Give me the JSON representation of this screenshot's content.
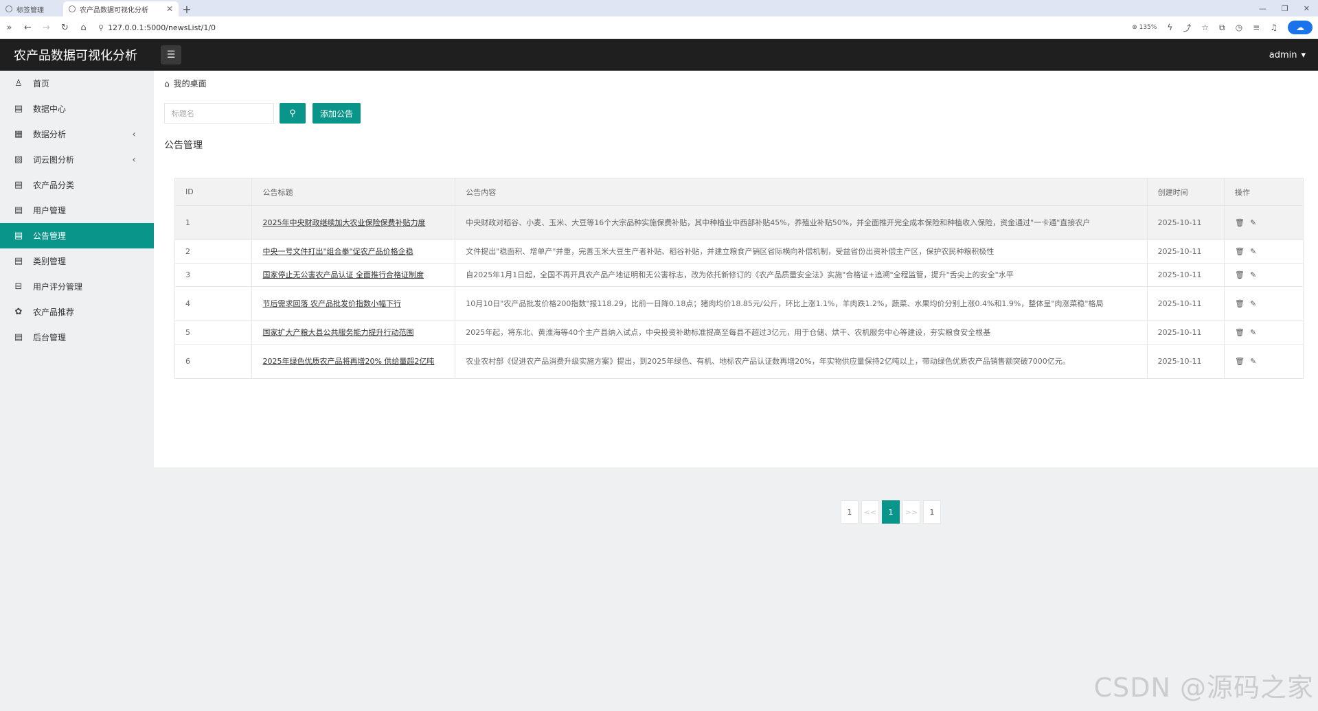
{
  "browser": {
    "tabs": [
      {
        "label": "标签管理",
        "active": false
      },
      {
        "label": "农产品数据可视化分析",
        "active": true
      }
    ],
    "url": "127.0.0.1:5000/newsList/1/0",
    "zoom": "135%"
  },
  "app": {
    "title": "农产品数据可视化分析",
    "user": "admin"
  },
  "sidebar": {
    "items": [
      {
        "label": "首页",
        "icon": "user-icon",
        "active": false,
        "expandable": false
      },
      {
        "label": "数据中心",
        "icon": "document-icon",
        "active": false,
        "expandable": false
      },
      {
        "label": "数据分析",
        "icon": "table-icon",
        "active": false,
        "expandable": true
      },
      {
        "label": "词云图分析",
        "icon": "image-icon",
        "active": false,
        "expandable": true
      },
      {
        "label": "农产品分类",
        "icon": "document-icon",
        "active": false,
        "expandable": false
      },
      {
        "label": "用户管理",
        "icon": "document-icon",
        "active": false,
        "expandable": false
      },
      {
        "label": "公告管理",
        "icon": "document-icon",
        "active": true,
        "expandable": false
      },
      {
        "label": "类别管理",
        "icon": "document-icon",
        "active": false,
        "expandable": false
      },
      {
        "label": "用户评分管理",
        "icon": "book-icon",
        "active": false,
        "expandable": false
      },
      {
        "label": "农产品推荐",
        "icon": "plant-icon",
        "active": false,
        "expandable": false
      },
      {
        "label": "后台管理",
        "icon": "document-icon",
        "active": false,
        "expandable": false
      }
    ]
  },
  "breadcrumb": "我的桌面",
  "search": {
    "placeholder": "标题名",
    "value": "",
    "add_label": "添加公告"
  },
  "section_title": "公告管理",
  "table": {
    "headers": [
      "ID",
      "公告标题",
      "公告内容",
      "创建时间",
      "操作"
    ],
    "rows": [
      {
        "id": "1",
        "title": "2025年中央财政继续加大农业保险保费补贴力度",
        "content": "中央财政对稻谷、小麦、玉米、大豆等16个大宗品种实施保费补贴，其中种植业中西部补贴45%，养殖业补贴50%，并全面推开完全成本保险和种植收入保险，资金通过\"一卡通\"直接农户",
        "date": "2025-10-11"
      },
      {
        "id": "2",
        "title": "中央一号文件打出\"组合拳\"促农产品价格企稳",
        "content": "文件提出\"稳面积、增单产\"并重，完善玉米大豆生产者补贴、稻谷补贴，并建立粮食产销区省际横向补偿机制，受益省份出资补偿主产区，保护农民种粮积极性",
        "date": "2025-10-11"
      },
      {
        "id": "3",
        "title": "国家停止无公害农产品认证 全面推行合格证制度",
        "content": "自2025年1月1日起，全国不再开具农产品产地证明和无公害标志，改为依托新修订的《农产品质量安全法》实施\"合格证+追溯\"全程监管，提升\"舌尖上的安全\"水平",
        "date": "2025-10-11"
      },
      {
        "id": "4",
        "title": "节后需求回落 农产品批发价指数小幅下行",
        "content": "10月10日\"农产品批发价格200指数\"报118.29，比前一日降0.18点；猪肉均价18.85元/公斤，环比上涨1.1%，羊肉跌1.2%，蔬菜、水果均价分别上涨0.4%和1.9%，整体呈\"肉涨菜稳\"格局",
        "date": "2025-10-11"
      },
      {
        "id": "5",
        "title": "国家扩大产粮大县公共服务能力提升行动范围",
        "content": "2025年起，将东北、黄淮海等40个主产县纳入试点，中央投资补助标准提高至每县不超过3亿元，用于仓储、烘干、农机服务中心等建设，夯实粮食安全根基",
        "date": "2025-10-11"
      },
      {
        "id": "6",
        "title": "2025年绿色优质农产品将再增20% 供给量超2亿吨",
        "content": "农业农村部《促进农产品消费升级实施方案》提出，到2025年绿色、有机、地标农产品认证数再增20%，年实物供应量保持2亿吨以上，带动绿色优质农产品销售额突破7000亿元。",
        "date": "2025-10-11"
      }
    ]
  },
  "pagination": {
    "first": "1",
    "prev": "<<",
    "current": "1",
    "next": ">>",
    "last": "1"
  },
  "watermark": "CSDN @源码之家"
}
